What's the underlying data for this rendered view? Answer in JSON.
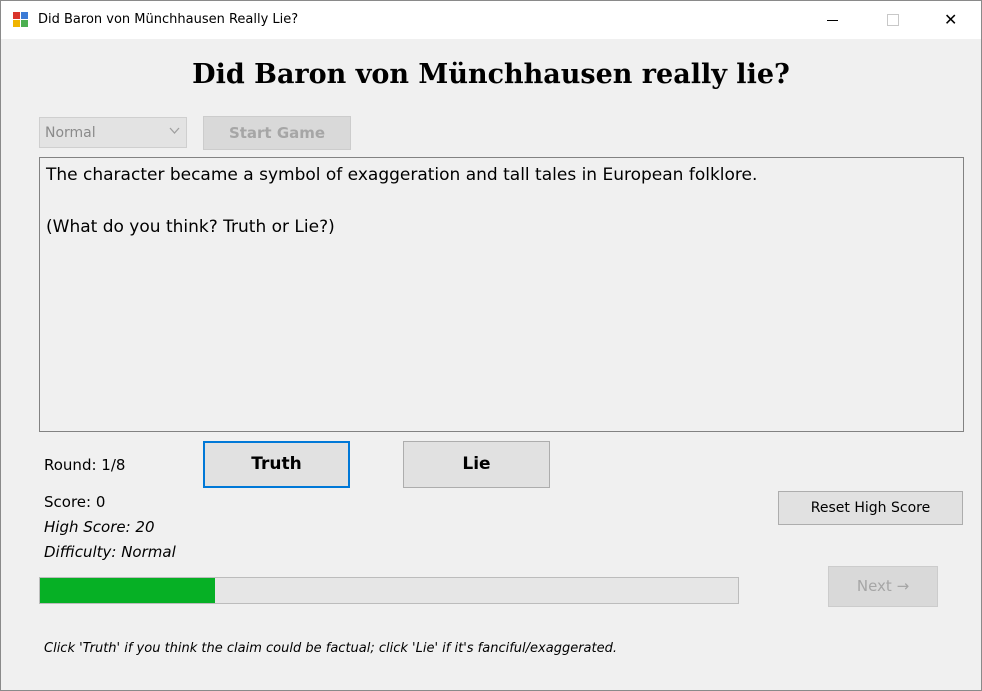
{
  "window": {
    "title": "Did Baron von Münchhausen Really Lie?",
    "icon": "windows-app-icon",
    "controls": {
      "minimize": "minimize-icon",
      "maximize": "maximize-icon",
      "close": "✕"
    }
  },
  "heading": "Did Baron von Münchhausen really lie?",
  "difficulty_select": {
    "value": "Normal",
    "arrow": "⌵"
  },
  "start_button": "Start Game",
  "claim_text": "The character became a symbol of exaggeration and tall tales in European folklore.\n\n(What do you think? Truth or Lie?)",
  "round": "Round: 1/8",
  "truth_button": "Truth",
  "lie_button": "Lie",
  "score": "Score: 0",
  "high_score": "High Score: 20",
  "difficulty": "Difficulty: Normal",
  "reset_button": "Reset High Score",
  "progress": {
    "fraction": 0.25,
    "color": "#06b025"
  },
  "next_button": "Next →",
  "hint": "Click 'Truth' if you think the claim could be factual; click 'Lie' if it's fanciful/exaggerated.",
  "colors": {
    "focus_border": "#0078d7",
    "background": "#f0f0f0"
  }
}
